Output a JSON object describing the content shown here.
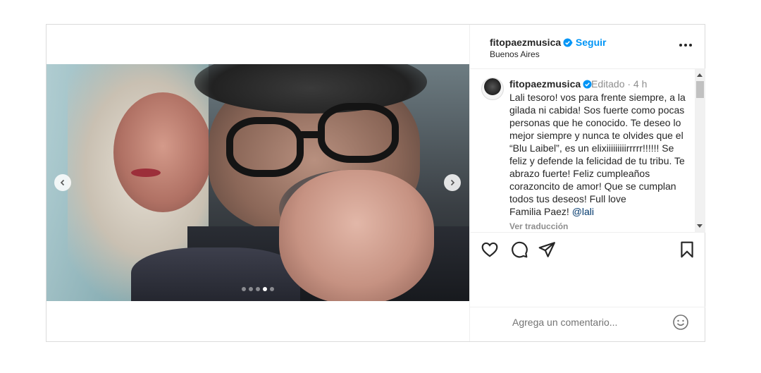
{
  "post": {
    "username": "fitopaezmusica",
    "follow_label": "Seguir",
    "follow_separator": "•",
    "location": "Buenos Aires"
  },
  "caption": {
    "username": "fitopaezmusica",
    "meta": "Editado · 4 h",
    "text_main": "Lali tesoro! vos para frente siempre, a la gilada ni cabida! Sos fuerte como pocas personas que he conocido. Te deseo lo mejor siempre y nunca te olvides que el “Blu Laibel”, es un elixiiiiiiiiirrrrr!!!!!! Se feliz y defende la felicidad de tu tribu. Te abrazo fuerte! Feliz cumpleaños corazoncito de amor! Que se cumplan todos tus deseos! Full love\nFamilia Paez! ",
    "mention": "@lali",
    "translate_label": "Ver traducción"
  },
  "carousel": {
    "total_slides": 5,
    "active_slide": 4
  },
  "comment": {
    "placeholder": "Agrega un comentario..."
  },
  "icons": {
    "verified": "verified-badge-icon",
    "more": "more-options-icon",
    "like": "heart-icon",
    "comment": "comment-icon",
    "share": "share-icon",
    "save": "bookmark-icon",
    "emoji": "emoji-icon",
    "prev": "chevron-left-icon",
    "next": "chevron-right-icon"
  },
  "colors": {
    "link_blue": "#0095f6",
    "text": "#262626",
    "muted": "#8e8e8e",
    "verified": "#0095f6"
  }
}
